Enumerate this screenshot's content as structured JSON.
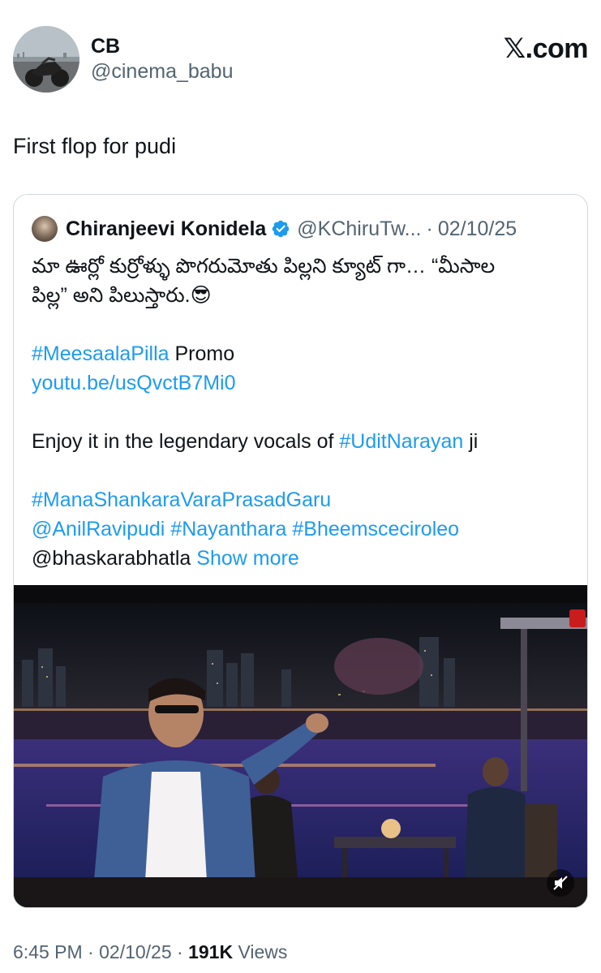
{
  "author": {
    "display_name": "CB",
    "handle": "@cinema_babu"
  },
  "brand": {
    "x_mark": "𝕏",
    "suffix": ".com"
  },
  "tweet": {
    "text": "First flop for pudi"
  },
  "quoted": {
    "display_name": "Chiranjeevi Konidela",
    "handle": "@KChiruTw...",
    "separator": "·",
    "date": "02/10/25",
    "telugu_line1": "మా ఊర్లో కుర్రోళ్ళు పొగరుమోతు పిల్లని క్యూట్ గా… “మీసాల",
    "telugu_line2": "పిల్ల” అని పిలుస్తారు.",
    "emoji": "😎",
    "hashtag_meesaala": "#MeesaalaPilla",
    "promo_word": " Promo",
    "youtube_link": "youtu.be/usQvctB7Mi0",
    "enjoy_prefix": "Enjoy it in the legendary vocals of ",
    "hashtag_udit": "#UditNarayan",
    "enjoy_suffix": " ji",
    "hashtag_mana": "#ManaShankaraVaraPrasadGaru",
    "mention_anil": "@AnilRavipudi",
    "hashtag_nayan": "#Nayanthara",
    "hashtag_bheems": "#Bheemsceciroleo",
    "mention_bhaskara": "@bhaskarabhatla",
    "show_more": "Show more"
  },
  "footer": {
    "time": "6:45 PM",
    "sep1": " · ",
    "date": "02/10/25",
    "sep2": " · ",
    "views_count": "191K",
    "views_label": " Views"
  },
  "colors": {
    "link": "#1d9bf0",
    "secondary_text": "#536471",
    "verified_badge": "#1d9bf0",
    "border": "#cfd9de"
  },
  "icons": {
    "verified": "verified-badge-icon",
    "mute": "volume-muted-icon"
  }
}
